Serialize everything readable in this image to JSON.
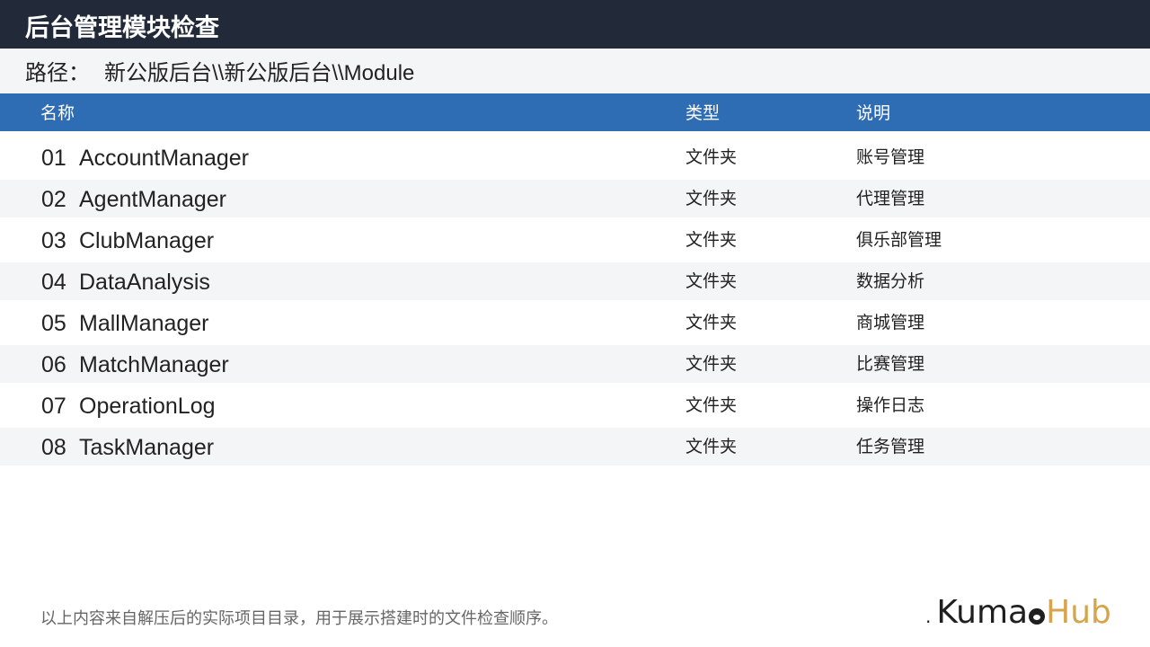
{
  "header": {
    "title": "后台管理模块检查"
  },
  "path": {
    "label": "路径：",
    "value": "新公版后台\\\\新公版后台\\\\Module"
  },
  "table": {
    "columns": {
      "name": "名称",
      "type": "类型",
      "desc": "说明"
    },
    "rows": [
      {
        "num": "01",
        "name": "AccountManager",
        "type": "文件夹",
        "desc": "账号管理"
      },
      {
        "num": "02",
        "name": "AgentManager",
        "type": "文件夹",
        "desc": "代理管理"
      },
      {
        "num": "03",
        "name": "ClubManager",
        "type": "文件夹",
        "desc": "俱乐部管理"
      },
      {
        "num": "04",
        "name": "DataAnalysis",
        "type": "文件夹",
        "desc": "数据分析"
      },
      {
        "num": "05",
        "name": "MallManager",
        "type": "文件夹",
        "desc": "商城管理"
      },
      {
        "num": "06",
        "name": "MatchManager",
        "type": "文件夹",
        "desc": "比赛管理"
      },
      {
        "num": "07",
        "name": "OperationLog",
        "type": "文件夹",
        "desc": "操作日志"
      },
      {
        "num": "08",
        "name": "TaskManager",
        "type": "文件夹",
        "desc": "任务管理"
      }
    ]
  },
  "footer": {
    "note": "以上内容来自解压后的实际项目目录，用于展示搭建时的文件检查顺序。",
    "logo": {
      "dot": ".",
      "part1": "Kuma",
      "part2": "Hub"
    }
  },
  "colors": {
    "title_bar": "#222a39",
    "header_bar": "#2e6db4",
    "alt_row": "#f4f5f7",
    "logo_accent": "#d6a54b"
  }
}
